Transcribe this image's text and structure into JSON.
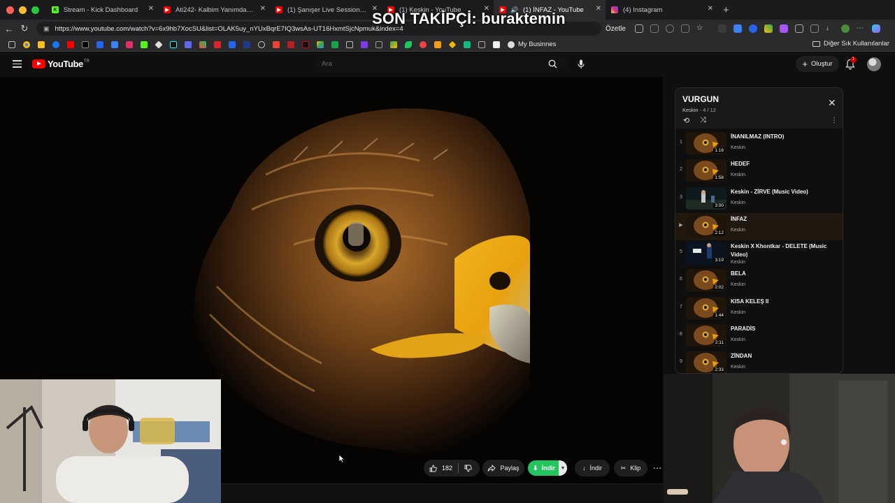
{
  "browser": {
    "tabs": [
      {
        "label": "Stream - Kick Dashboard",
        "icon": "kick-icon",
        "color": "#53fc18"
      },
      {
        "label": "Ati242- Kalbim Yanımda (Offici…",
        "icon": "youtube-icon",
        "color": "#ff0000"
      },
      {
        "label": "(1) Şanışer Live Sessions - Çan…",
        "icon": "youtube-icon",
        "color": "#ff0000"
      },
      {
        "label": "(1) Keskin - YouTube",
        "icon": "youtube-icon",
        "color": "#ff0000"
      },
      {
        "label": "(1) İNFAZ - YouTube",
        "icon": "youtube-icon",
        "color": "#ff0000",
        "active": true
      },
      {
        "label": "(4) Instagram",
        "icon": "instagram-icon",
        "color": "#e1306c"
      }
    ],
    "url": "https://www.youtube.com/watch?v=6x9hb7XocSU&list=OLAK5uy_nYUxBqrE7IQ3wsAs-UT16HxmtSjcNpmuk&index=4",
    "ozetle_label": "Özetle",
    "bookmark_business": "My Businnes",
    "bookmark_other": "Diğer Sık Kullanılanlar"
  },
  "overlay": {
    "text": "SON TAKİPÇİ: buraktemin"
  },
  "youtube": {
    "logo_text": "YouTube",
    "logo_region": "TR",
    "search_placeholder": "Ara",
    "create_label": "Oluştur",
    "notification_count": "1"
  },
  "actions": {
    "like_count": "182",
    "share_label": "Paylaş",
    "indir_label": "İndir",
    "download_label": "İndir",
    "clip_label": "Klip"
  },
  "playlist": {
    "title": "VURGUN",
    "artist": "Keskin",
    "position": "4 / 12",
    "items": [
      {
        "index": "1",
        "title": "İNANILMAZ (INTRO)",
        "artist": "Keskin",
        "duration": "1:16"
      },
      {
        "index": "2",
        "title": "HEDEF",
        "artist": "Keskin",
        "duration": "1:58"
      },
      {
        "index": "3",
        "title": "Keskin - ZİRVE (Music Video)",
        "artist": "Keskin",
        "duration": "3:00"
      },
      {
        "index": "▶",
        "title": "İNFAZ",
        "artist": "Keskin",
        "duration": "2:12",
        "current": true
      },
      {
        "index": "5",
        "title": "Keskin X Khontkar - DELETE (Music Video)",
        "artist": "Keskin",
        "duration": "3:19"
      },
      {
        "index": "6",
        "title": "BELA",
        "artist": "Keskin",
        "duration": "2:02"
      },
      {
        "index": "7",
        "title": "KISA KELEŞ II",
        "artist": "Keskin",
        "duration": "1:44"
      },
      {
        "index": "8",
        "title": "PARADİS",
        "artist": "Keskin",
        "duration": "2:11"
      },
      {
        "index": "9",
        "title": "ZİNDAN",
        "artist": "Keskin",
        "duration": "2:33"
      }
    ]
  }
}
